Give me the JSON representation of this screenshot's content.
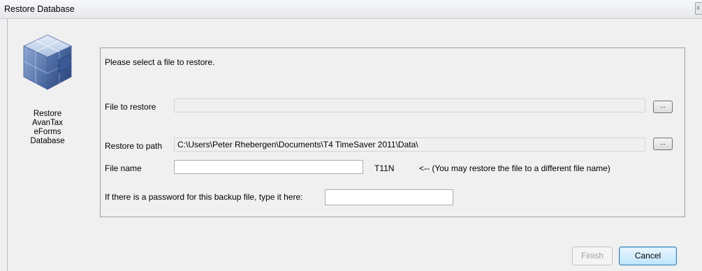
{
  "window": {
    "title": "Restore Database",
    "close_glyph": "x"
  },
  "sidebar": {
    "logo_icon": "database-cubes-icon",
    "caption_lines": [
      "Restore",
      "AvanTax",
      "eForms",
      "Database"
    ]
  },
  "form": {
    "instruction": "Please select a file to restore.",
    "file_to_restore": {
      "label": "File to restore",
      "value": "",
      "browse_label": "..."
    },
    "restore_to_path": {
      "label": "Restore to path",
      "value": "C:\\Users\\Peter Rhebergen\\Documents\\T4 TimeSaver 2011\\Data\\",
      "browse_label": "..."
    },
    "file_name": {
      "label": "File name",
      "value": "",
      "extension": "T11N",
      "hint": "<-- (You may restore the file to a different file name)"
    },
    "password": {
      "label": "If there is a password for this backup file, type it here:",
      "value": ""
    }
  },
  "buttons": {
    "finish": "Finish",
    "cancel": "Cancel"
  },
  "colors": {
    "window_bg": "#f0f0f0",
    "accent_button_border": "#3c7fb1"
  }
}
